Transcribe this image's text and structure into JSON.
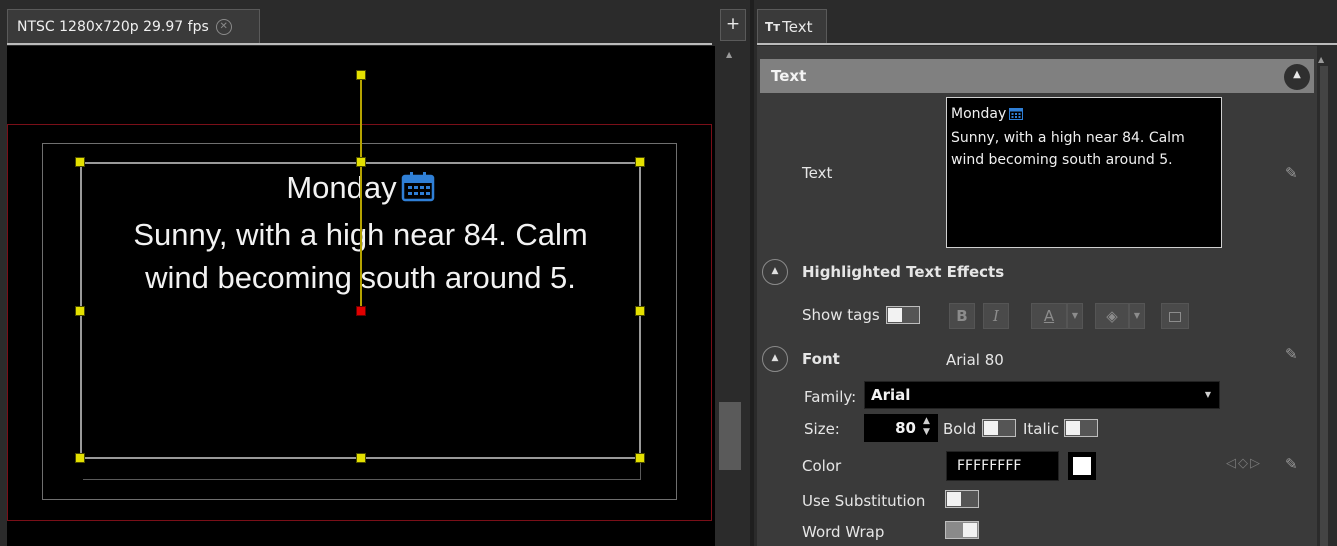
{
  "left_panel": {
    "tab_label": "NTSC 1280x720p 29.97 fps",
    "add_button": "+",
    "canvas_text": {
      "title": "Monday",
      "line1": "Sunny, with a high near 84. Calm",
      "line2": "wind becoming south around 5."
    }
  },
  "right_panel": {
    "tab_icon": "Tт",
    "tab_label": "Text",
    "section_title": "Text",
    "text_field": {
      "label": "Text",
      "line1": "Monday",
      "line2": "Sunny, with a high near 84. Calm",
      "line3": "wind becoming south around 5."
    },
    "highlighted": {
      "title": "Highlighted Text Effects",
      "show_tags_label": "Show tags",
      "show_tags": false,
      "bold_btn": "B",
      "italic_btn": "I",
      "font_color_btn": "A"
    },
    "font": {
      "title": "Font",
      "summary": "Arial 80",
      "family_label": "Family:",
      "family_value": "Arial",
      "size_label": "Size:",
      "size_value": "80",
      "bold_label": "Bold",
      "bold": false,
      "italic_label": "Italic",
      "italic": false,
      "color_label": "Color",
      "color_value": "FFFFFFFF",
      "swatch_color": "#ffffff",
      "use_substitution_label": "Use Substitution",
      "use_substitution": false,
      "word_wrap_label": "Word Wrap",
      "word_wrap": true
    }
  },
  "colors": {
    "handle": "#e4e000",
    "anchor": "#e00000",
    "safe_area": "#7a0f18",
    "header_bg": "#808080"
  }
}
